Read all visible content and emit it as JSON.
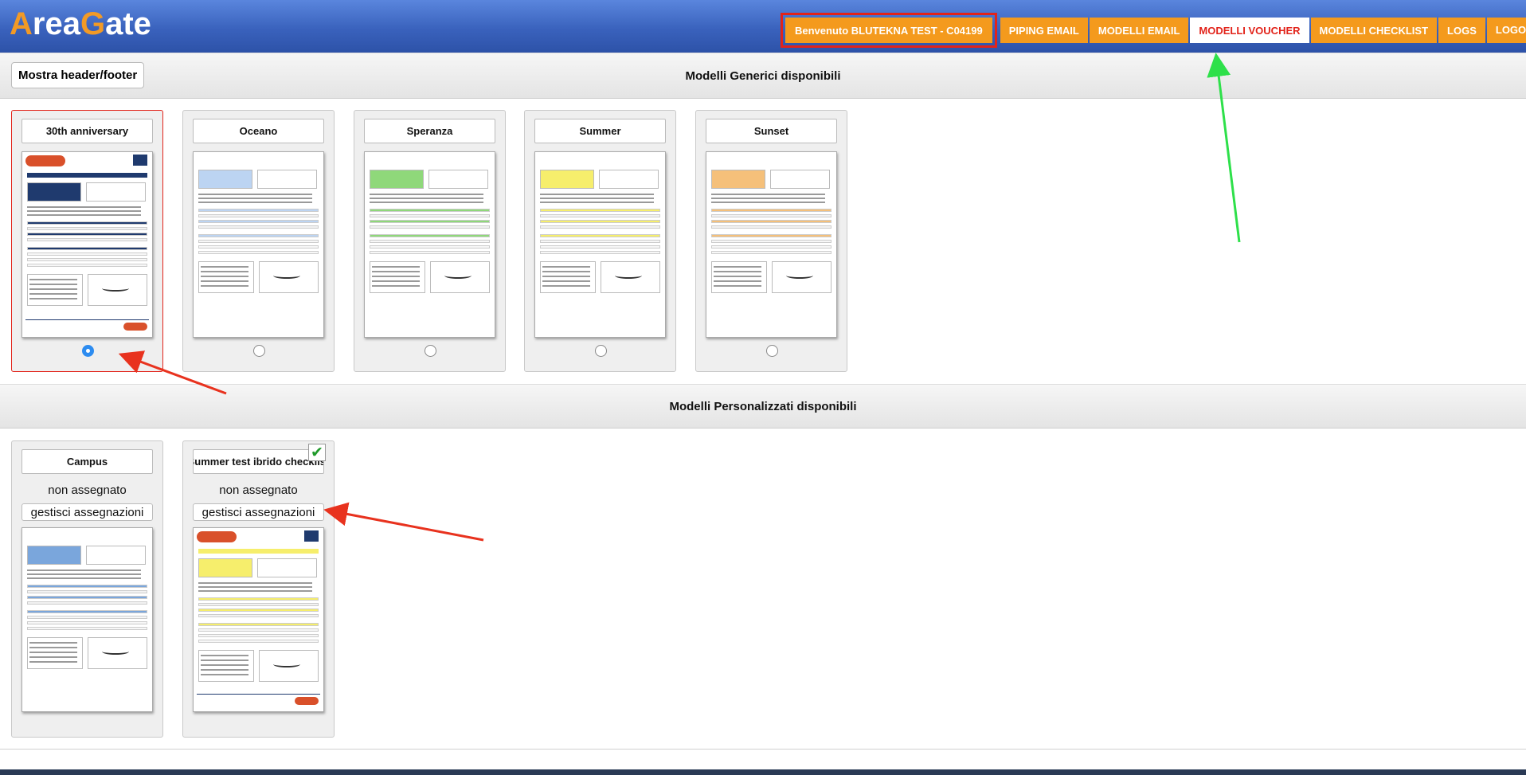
{
  "header": {
    "logo_a": "A",
    "logo_rea": "rea",
    "logo_g": "G",
    "logo_ate": "ate",
    "nav": [
      {
        "label": "Benvenuto BLUTEKNA TEST - C04199"
      },
      {
        "label": "PIPING EMAIL"
      },
      {
        "label": "MODELLI EMAIL"
      },
      {
        "label": "MODELLI VOUCHER"
      },
      {
        "label": "MODELLI CHECKLIST"
      },
      {
        "label": "LOGS"
      },
      {
        "label": "LOGOUT ⇒"
      }
    ]
  },
  "toolbar": {
    "toggle_label": "Mostra header/footer"
  },
  "generic": {
    "title": "Modelli Generici disponibili",
    "templates": [
      {
        "name": "30th anniversary",
        "accent": "#1f3a6e",
        "selected": true
      },
      {
        "name": "Oceano",
        "accent": "#bcd4f2",
        "selected": false
      },
      {
        "name": "Speranza",
        "accent": "#8fd87a",
        "selected": false
      },
      {
        "name": "Summer",
        "accent": "#f6ee6c",
        "selected": false
      },
      {
        "name": "Sunset",
        "accent": "#f5c07a",
        "selected": false
      }
    ]
  },
  "custom": {
    "title": "Modelli Personalizzati disponibili",
    "templates": [
      {
        "name": "Campus",
        "status": "non assegnato",
        "manage_label": "gestisci assegnazioni",
        "accent": "#7aa6dc"
      },
      {
        "name": "Summer test ibrido checklist",
        "status": "non assegnato",
        "manage_label": "gestisci assegnazioni",
        "accent": "#f6ee6c"
      }
    ]
  },
  "colors": {
    "nav_orange": "#f49a1d",
    "active_red": "#e2231a",
    "annotation_green": "#2ee04a",
    "annotation_red": "#e8321e"
  }
}
